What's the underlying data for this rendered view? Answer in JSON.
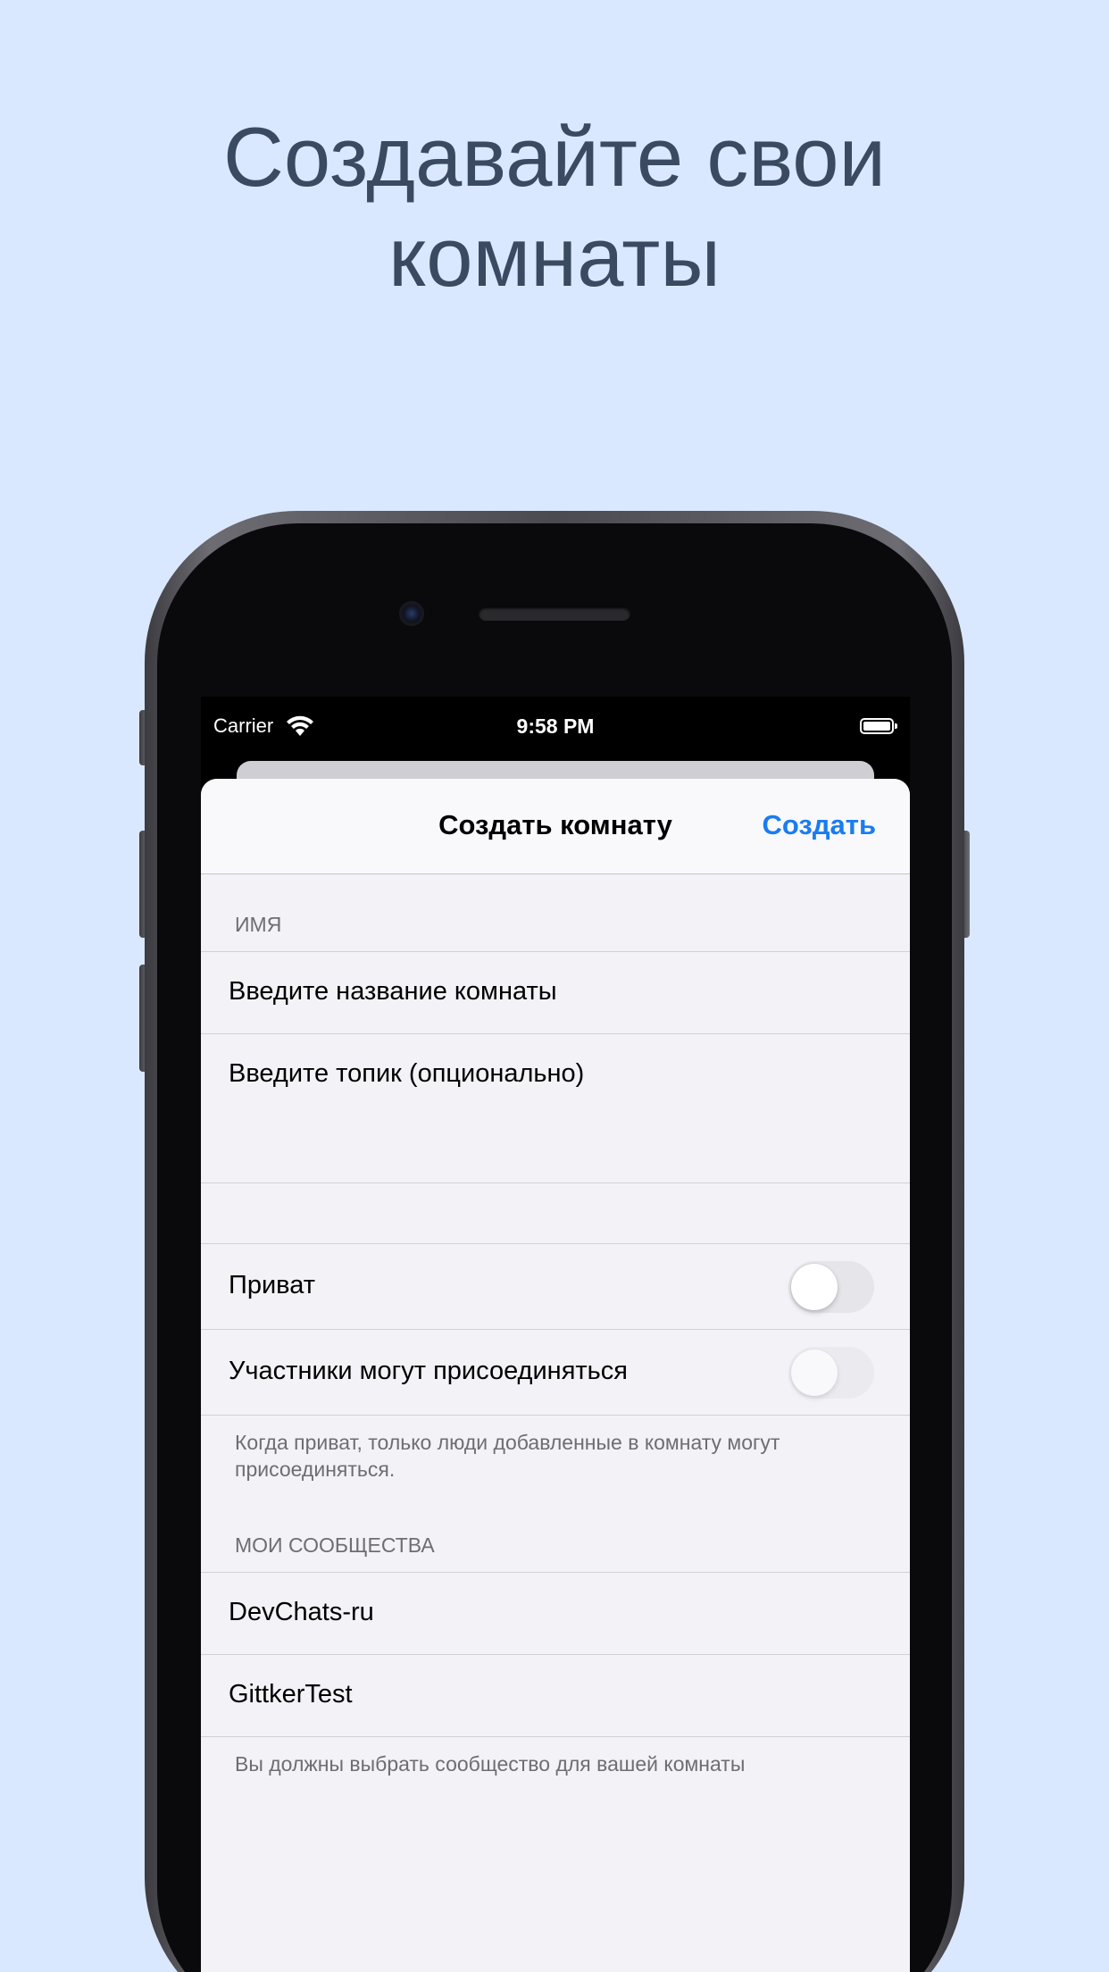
{
  "headline": {
    "line1": "Создавайте свои",
    "line2": "комнаты"
  },
  "status_bar": {
    "carrier": "Carrier",
    "time": "9:58 PM",
    "wifi_icon": "wifi-icon",
    "battery_icon": "battery-icon"
  },
  "navbar": {
    "title": "Создать комнату",
    "create_label": "Создать"
  },
  "name_section": {
    "header": "ИМЯ",
    "room_name_placeholder": "Введите название комнаты",
    "topic_placeholder": "Введите топик (опционально)"
  },
  "options_section": {
    "private_label": "Приват",
    "private_on": false,
    "members_join_label": "Участники могут присоединяться",
    "members_join_on": false,
    "footer": "Когда приват, только люди добавленные в комнату могут присоединяться."
  },
  "communities_section": {
    "header": "МОИ СООБЩЕСТВА",
    "items": [
      "DevChats-ru",
      "GittkerTest"
    ],
    "footer": "Вы должны выбрать сообщество для вашей комнаты"
  },
  "colors": {
    "background": "#dae8ff",
    "headline": "#3a4a60",
    "accent": "#1a7cf0",
    "grouped_background": "#f2f2f7"
  }
}
